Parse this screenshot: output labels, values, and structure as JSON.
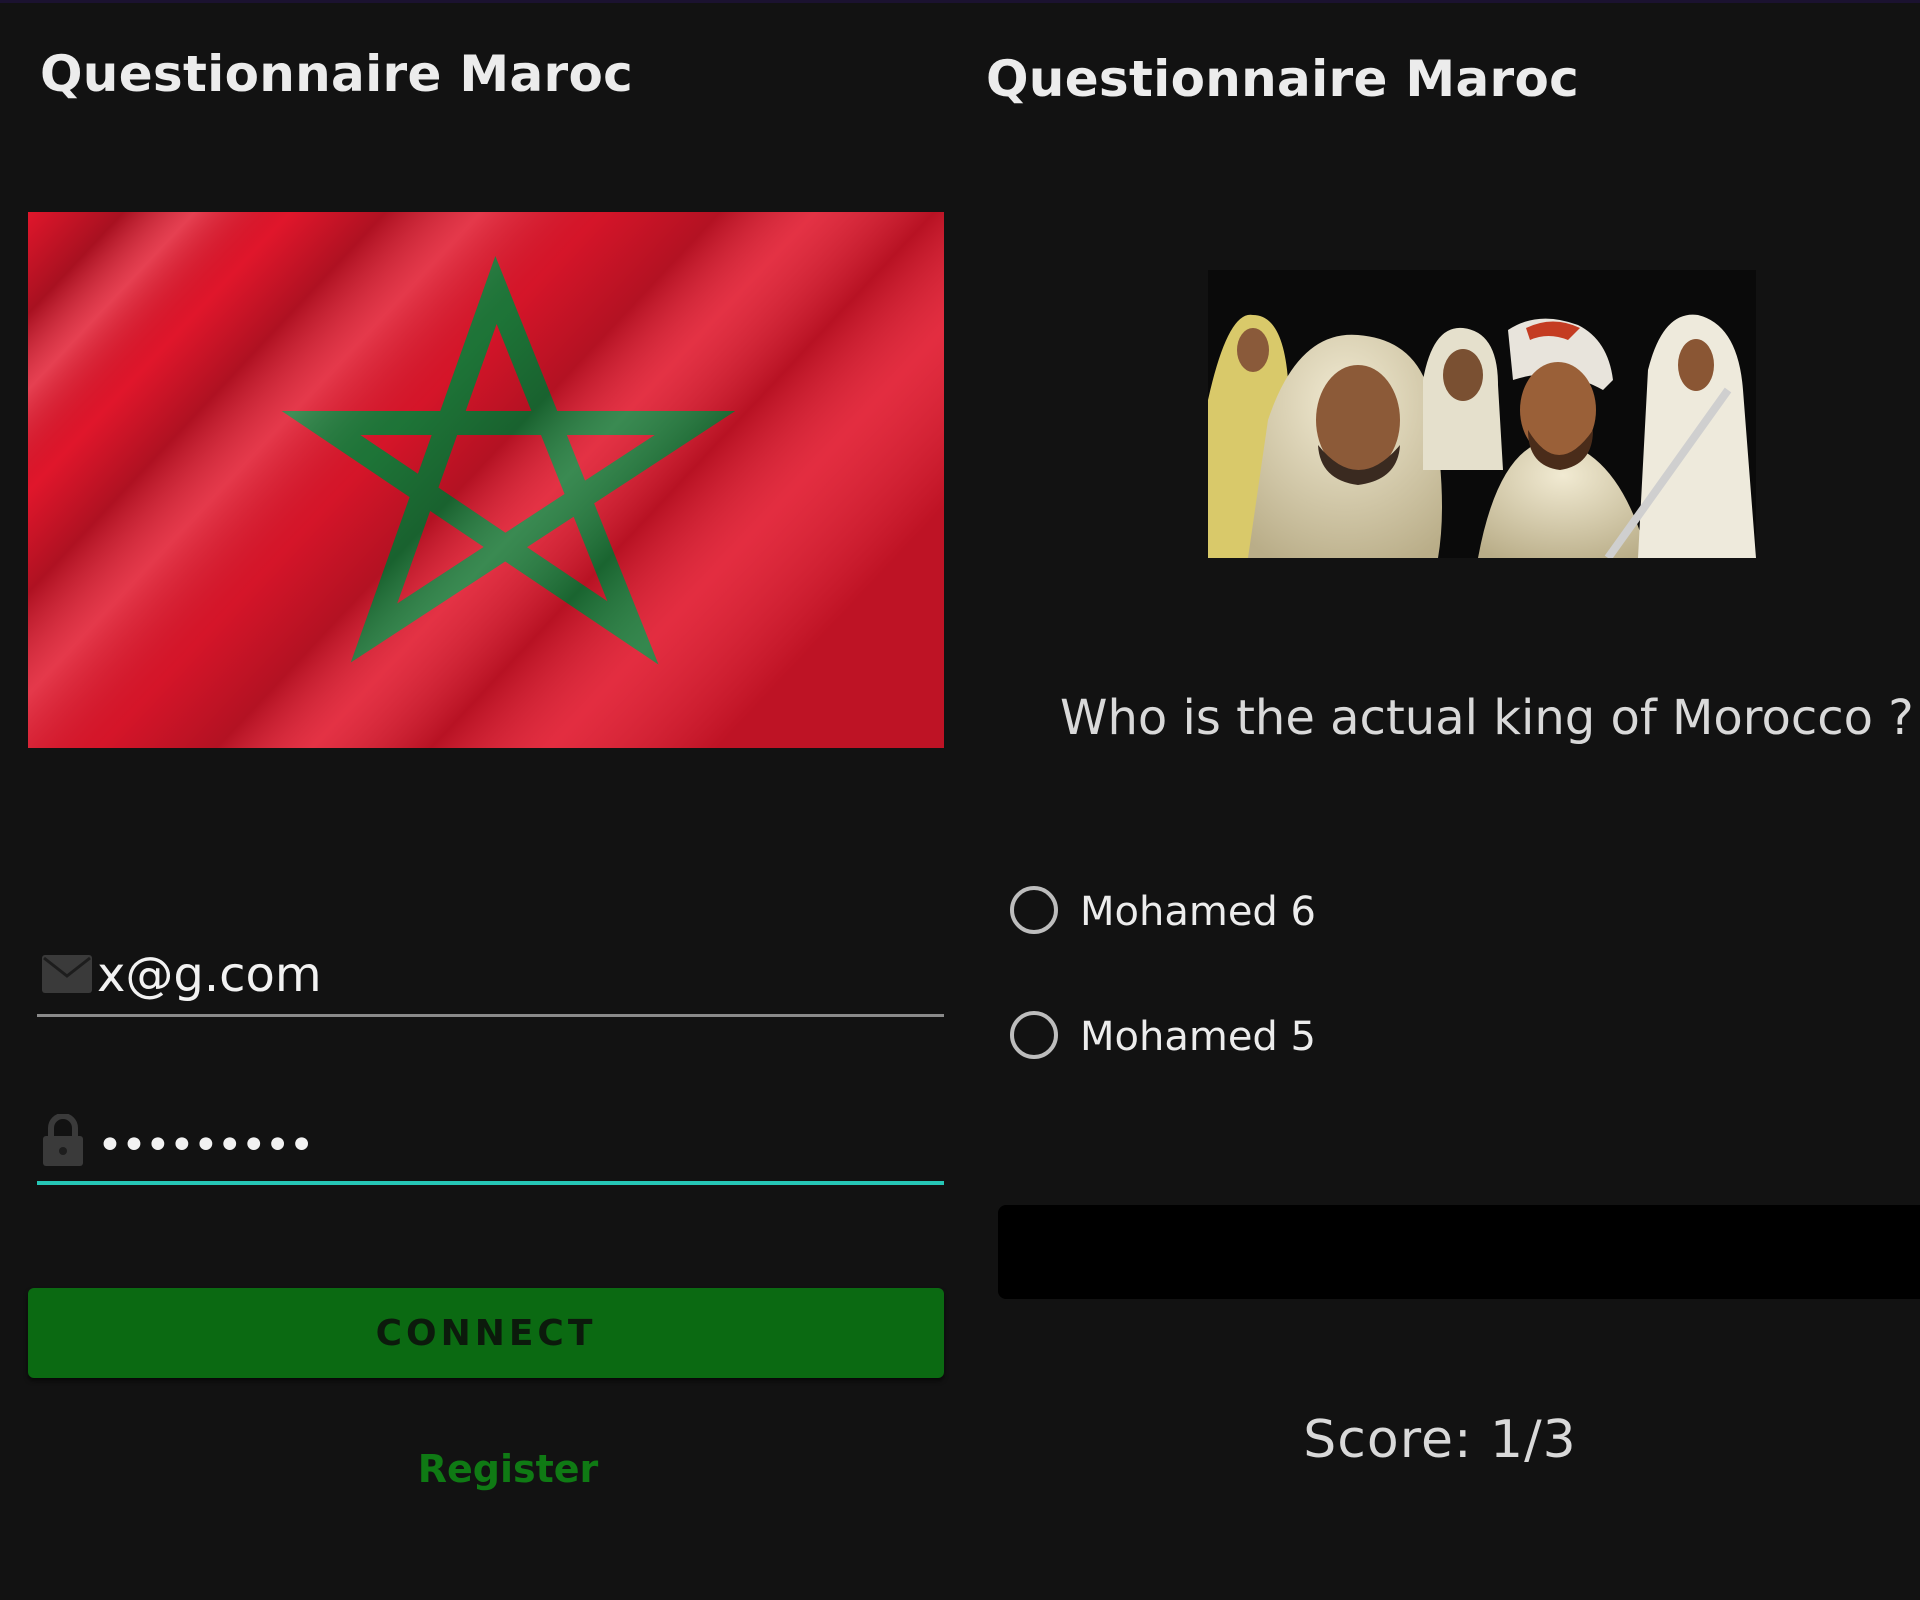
{
  "login": {
    "title": "Questionnaire Maroc",
    "email": {
      "value": "x@g.com",
      "icon": "envelope-icon"
    },
    "password": {
      "value": "•••••••••",
      "icon": "lock-icon"
    },
    "connect_label": "CONNECT",
    "register_label": "Register"
  },
  "quiz": {
    "title": "Questionnaire Maroc",
    "image_alt": "Historical Moroccan figures",
    "question": "Who is the actual king of Morocco ?",
    "options": [
      {
        "label": "Mohamed 6",
        "selected": false
      },
      {
        "label": "Mohamed 5",
        "selected": false
      }
    ],
    "score": "Score: 1/3"
  },
  "colors": {
    "background": "#121212",
    "accent": "#26c6b6",
    "button": "#0b6a12",
    "link": "#0f7a14",
    "flag_red": "#e0162b",
    "flag_green": "#1f7a3a"
  }
}
